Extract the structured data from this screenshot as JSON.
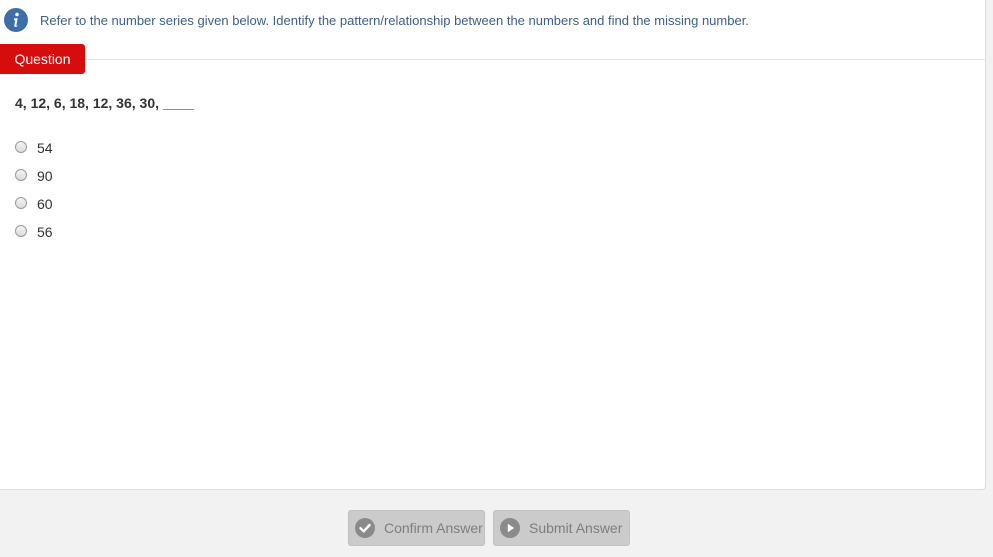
{
  "instruction": {
    "icon": "info-icon",
    "text": "Refer to the number series given below. Identify the pattern/relationship between the numbers and find the missing number."
  },
  "question_tab": {
    "label": "Question",
    "color": "#d60d0d"
  },
  "question": {
    "text": "4, 12, 6, 18, 12, 36, 30, ____"
  },
  "options": [
    {
      "label": "54"
    },
    {
      "label": "90"
    },
    {
      "label": "60"
    },
    {
      "label": "56"
    }
  ],
  "buttons": {
    "confirm": {
      "label": "Confirm Answer",
      "icon": "check-circle-icon"
    },
    "submit": {
      "label": "Submit Answer",
      "icon": "play-circle-icon"
    }
  },
  "colors": {
    "info_icon": "#3d6ea8",
    "instruction_text": "#3e5f86",
    "disabled_button": "#cbcbcb"
  }
}
